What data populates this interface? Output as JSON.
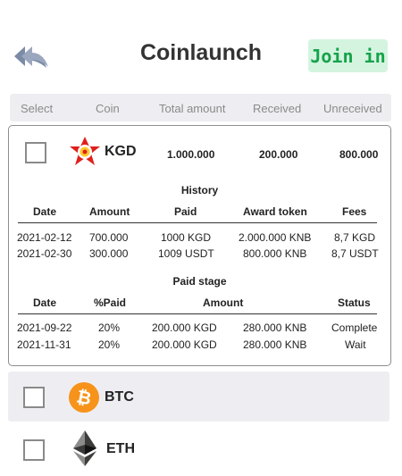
{
  "header": {
    "title": "Coinlaunch",
    "join_label": "Join in"
  },
  "columns": [
    "Select",
    "Coin",
    "Total amount",
    "Received",
    "Unreceived"
  ],
  "coins": [
    {
      "symbol": "KGD",
      "icon": "kgd-logo-icon",
      "total": "1.000.000",
      "received": "200.000",
      "unreceived": "800.000",
      "history": {
        "title": "History",
        "headers": [
          "Date",
          "Amount",
          "Paid",
          "Award token",
          "Fees"
        ],
        "rows": [
          [
            "2021-02-12",
            "700.000",
            "1000 KGD",
            "2.000.000 KNB",
            "8,7 KGD"
          ],
          [
            "2021-02-30",
            "300.000",
            "1009 USDT",
            "800.000 KNB",
            "8,7 USDT"
          ]
        ]
      },
      "paid_stage": {
        "title": "Paid stage",
        "headers": [
          "Date",
          "%Paid",
          "Amount",
          "Status"
        ],
        "rows": [
          [
            "2021-09-22",
            "20%",
            "200.000 KGD",
            "280.000 KNB",
            "Complete"
          ],
          [
            "2021-11-31",
            "20%",
            "200.000 KGD",
            "280.000 KNB",
            "Wait"
          ]
        ]
      }
    },
    {
      "symbol": "BTC",
      "icon": "bitcoin-icon",
      "color": "#f7931a"
    },
    {
      "symbol": "ETH",
      "icon": "ethereum-icon"
    }
  ],
  "colors": {
    "join_bg": "#d4f4e0",
    "join_text": "#16a34a",
    "header_row_bg": "#eeeef2",
    "kgd_red": "#e0201c",
    "btc_orange": "#f7931a"
  }
}
